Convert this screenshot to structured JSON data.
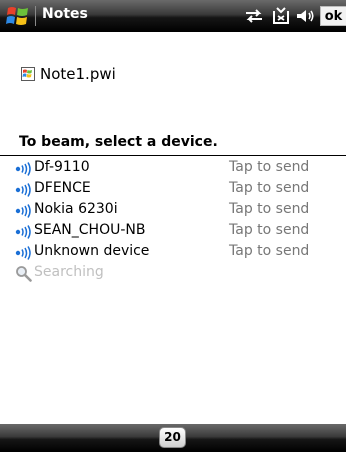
{
  "window": {
    "title": "Notes",
    "ok_label": "ok"
  },
  "status_icons": [
    "sync-icon",
    "signal-off-icon",
    "speaker-icon"
  ],
  "file": {
    "name": "Note1.pwi",
    "icon": "note-file-icon"
  },
  "beam": {
    "header": "To beam, select a device.",
    "devices": [
      {
        "name": "Df-9110",
        "action": "Tap to send"
      },
      {
        "name": "DFENCE",
        "action": "Tap to send"
      },
      {
        "name": "Nokia 6230i",
        "action": "Tap to send"
      },
      {
        "name": "SEAN_CHOU-NB",
        "action": "Tap to send"
      },
      {
        "name": "Unknown device",
        "action": "Tap to send"
      }
    ],
    "searching_text": "Searching"
  },
  "bottom_bar": {
    "input_button_label": "20"
  },
  "colors": {
    "bar_dark": "#000000",
    "beam_icon_blue": "#1a6fd6",
    "action_gray": "#777777",
    "searching_gray": "#c0c0c0"
  }
}
